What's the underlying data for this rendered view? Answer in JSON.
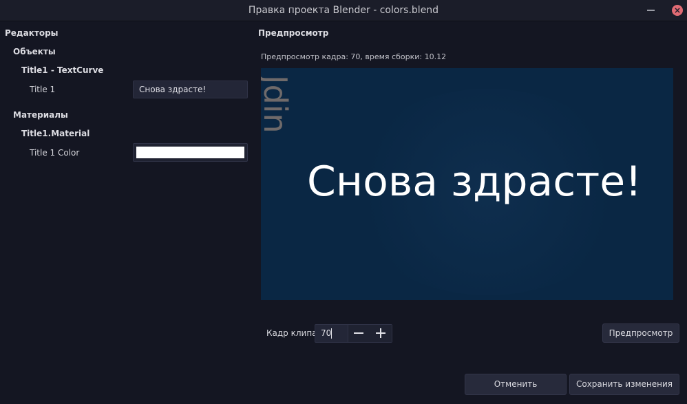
{
  "window": {
    "title": "Правка проекта Blender - colors.blend"
  },
  "editors": {
    "heading": "Редакторы",
    "objects_heading": "Объекты",
    "object_name": "Title1 - TextCurve",
    "title_label": "Title 1",
    "title_value": "Снова здрасте!",
    "materials_heading": "Материалы",
    "material_name": "Title1.Material",
    "color_label": "Title 1 Color",
    "color_value": "#ffffff"
  },
  "preview": {
    "heading": "Предпросмотр",
    "info": "Предпросмотр кадра: 70, время сборки: 10.12",
    "main_text": "Снова здрасте!",
    "vertical_text": "Jdin",
    "background_color": "#0a2744"
  },
  "controls": {
    "frame_label": "Кадр клипа",
    "frame_value": "70",
    "preview_button": "Предпросмотр",
    "cancel_button": "Отменить",
    "save_button": "Сохранить изменения"
  }
}
